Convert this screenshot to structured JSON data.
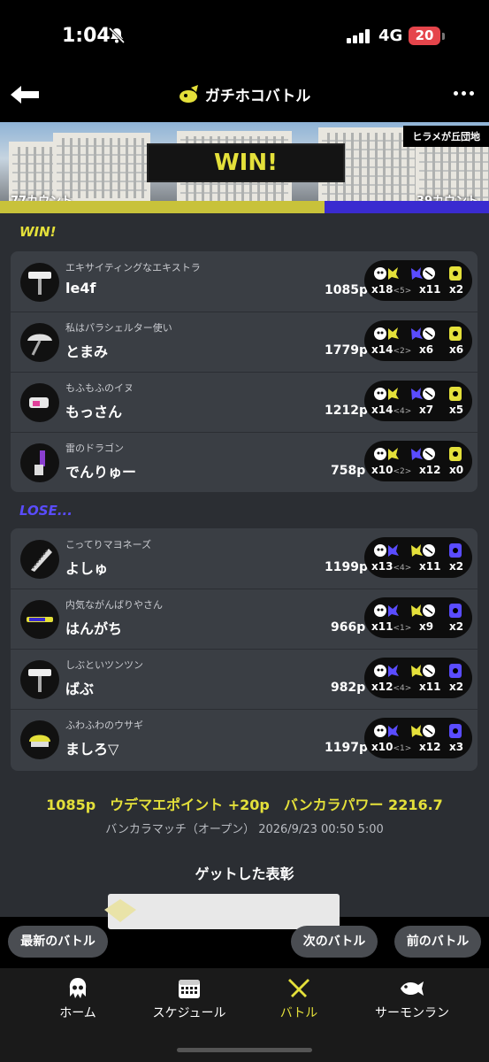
{
  "status_bar": {
    "time": "1:04",
    "network": "4G",
    "battery": "20"
  },
  "header": {
    "title": "ガチホコバトル"
  },
  "banner": {
    "stage": "ヒラメが丘団地",
    "result": "WIN!",
    "left_count": "77カウント",
    "right_count": "39カウント",
    "left_fraction": 0.664
  },
  "win_team": {
    "label": "WIN!",
    "players": [
      {
        "title": "エキサイティングなエキストラ",
        "name": "le4f",
        "points": "1085p",
        "kills": "x18",
        "assists": "<5>",
        "deaths": "x11",
        "special": "x2",
        "weapon_icon": "roller-icon"
      },
      {
        "title": "私はパラシェルター使い",
        "name": "とまみ",
        "points": "1779p",
        "kills": "x14",
        "assists": "<2>",
        "deaths": "x6",
        "special": "x6",
        "weapon_icon": "umbrella-icon"
      },
      {
        "title": "もふもふのイヌ",
        "name": "もっさん",
        "points": "1212p",
        "kills": "x14",
        "assists": "<4>",
        "deaths": "x7",
        "special": "x5",
        "weapon_icon": "blaster-icon"
      },
      {
        "title": "雷のドラゴン",
        "name": "でんりゅー",
        "points": "758p",
        "kills": "x10",
        "assists": "<2>",
        "deaths": "x12",
        "special": "x0",
        "weapon_icon": "brush-icon"
      }
    ]
  },
  "lose_team": {
    "label": "LOSE...",
    "players": [
      {
        "title": "こってりマヨネーズ",
        "name": "よしゅ",
        "points": "1199p",
        "kills": "x13",
        "assists": "<4>",
        "deaths": "x11",
        "special": "x2",
        "weapon_icon": "saw-icon"
      },
      {
        "title": "内気ながんばりやさん",
        "name": "はんがち",
        "points": "966p",
        "kills": "x11",
        "assists": "<1>",
        "deaths": "x9",
        "special": "x2",
        "weapon_icon": "charger-icon"
      },
      {
        "title": "しぶといツンツン",
        "name": "ばぶ",
        "points": "982p",
        "kills": "x12",
        "assists": "<4>",
        "deaths": "x11",
        "special": "x2",
        "weapon_icon": "roller-icon"
      },
      {
        "title": "ふわふわのウサギ",
        "name": "ましろ▽",
        "points": "1197p",
        "kills": "x10",
        "assists": "<1>",
        "deaths": "x12",
        "special": "x3",
        "weapon_icon": "shooter-icon"
      }
    ]
  },
  "summary": {
    "line": "1085p　ウデマエポイント +20p　バンカラパワー 2216.7",
    "match_info": "バンカラマッチ（オープン） 2026/9/23 00:50 5:00",
    "badge_title": "ゲットした表彰"
  },
  "buttons": {
    "latest": "最新のバトル",
    "next": "次のバトル",
    "prev": "前のバトル"
  },
  "tabs": [
    {
      "label": "ホーム",
      "icon": "squid-icon"
    },
    {
      "label": "スケジュール",
      "icon": "calendar-icon"
    },
    {
      "label": "バトル",
      "icon": "battle-icon"
    },
    {
      "label": "サーモンラン",
      "icon": "salmon-icon"
    }
  ],
  "colors": {
    "win": "#e4e03a",
    "lose": "#5a4cff",
    "panel": "#3a3e44",
    "background": "#2b2e33"
  }
}
